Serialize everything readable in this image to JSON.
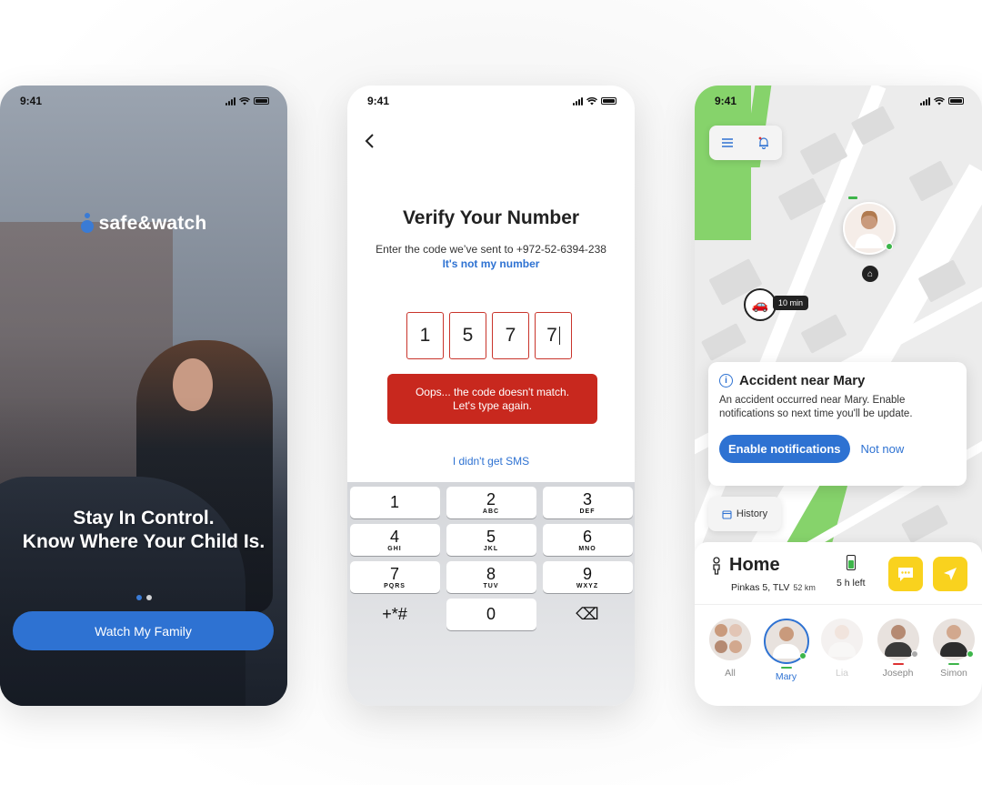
{
  "status": {
    "time": "9:41"
  },
  "screen1": {
    "logo_text": "safe&watch",
    "headline_line1": "Stay In Control.",
    "headline_line2": "Know Where Your Child Is.",
    "cta_label": "Watch My Family",
    "colors": {
      "accent": "#2e72d2"
    }
  },
  "screen2": {
    "title": "Verify Your Number",
    "subtitle": "Enter the code we’ve sent to +972-52-6394-238",
    "not_my_number": "It's not my number",
    "code_digits": [
      "1",
      "5",
      "7",
      "7"
    ],
    "error_line1": "Oops... the code doesn't match.",
    "error_line2": "Let's type again.",
    "no_sms_label": "I didn't get SMS",
    "keypad": [
      {
        "num": "1",
        "letters": ""
      },
      {
        "num": "2",
        "letters": "ABC"
      },
      {
        "num": "3",
        "letters": "DEF"
      },
      {
        "num": "4",
        "letters": "GHI"
      },
      {
        "num": "5",
        "letters": "JKL"
      },
      {
        "num": "6",
        "letters": "MNO"
      },
      {
        "num": "7",
        "letters": "PQRS"
      },
      {
        "num": "8",
        "letters": "TUV"
      },
      {
        "num": "9",
        "letters": "WXYZ"
      },
      {
        "num": "+*#",
        "letters": ""
      },
      {
        "num": "0",
        "letters": ""
      },
      {
        "num": "⌫",
        "letters": ""
      }
    ],
    "colors": {
      "error": "#c8281e"
    }
  },
  "screen3": {
    "eta_label": "10 min",
    "alert_title": "Accident near Mary",
    "alert_body": "An accident occurred near Mary. Enable notifications so next time you'll be update.",
    "enable_label": "Enable notifications",
    "not_now_label": "Not now",
    "history_label": "History",
    "place_title": "Home",
    "place_address": "Pinkas 5, TLV",
    "place_distance": "52 km",
    "battery_left": "5 h left",
    "members": [
      {
        "name": "All",
        "state": "normal"
      },
      {
        "name": "Mary",
        "state": "selected"
      },
      {
        "name": "Lia",
        "state": "faded"
      },
      {
        "name": "Joseph",
        "state": "normal"
      },
      {
        "name": "Simon",
        "state": "normal"
      }
    ],
    "colors": {
      "action_yellow": "#f9d21e",
      "map_green": "#86d36b",
      "online": "#3db54a"
    }
  }
}
